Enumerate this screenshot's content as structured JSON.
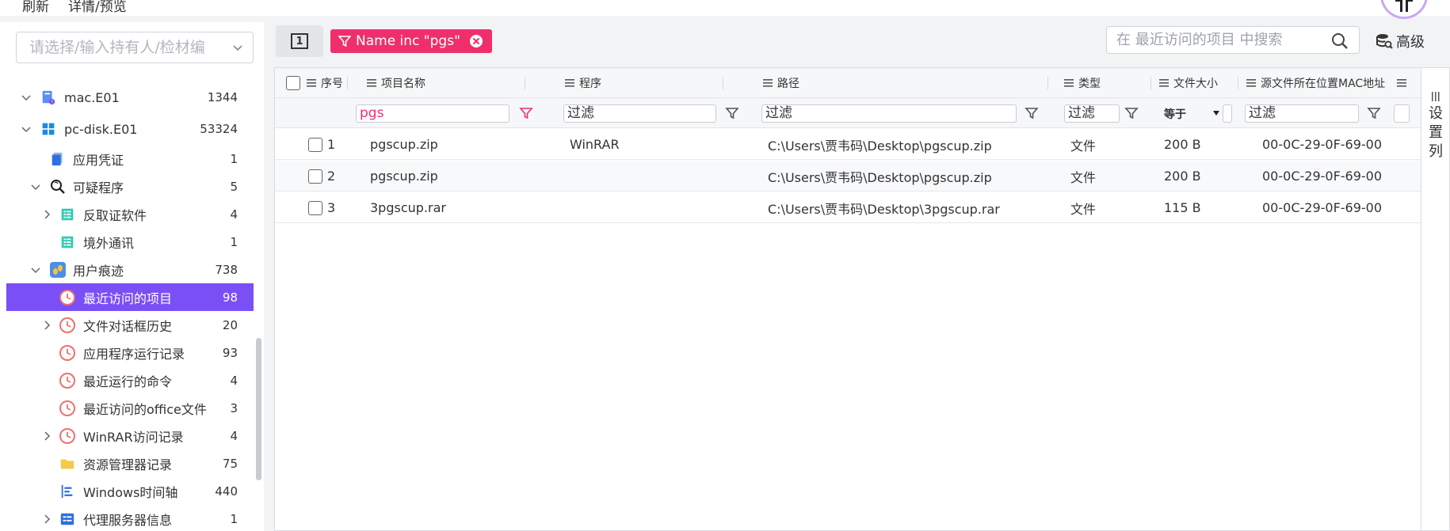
{
  "top_menu": [
    "刷新",
    "详情/预览"
  ],
  "sidebar": {
    "search_placeholder": "请选择/输入持有人/检材编",
    "items": [
      {
        "label": "mac.E01",
        "count": "1344"
      },
      {
        "label": "pc-disk.E01",
        "count": "53324"
      },
      {
        "label": "应用凭证",
        "count": "1"
      },
      {
        "label": "可疑程序",
        "count": "5"
      },
      {
        "label": "反取证软件",
        "count": "4"
      },
      {
        "label": "境外通讯",
        "count": "1"
      },
      {
        "label": "用户痕迹",
        "count": "738"
      },
      {
        "label": "最近访问的项目",
        "count": "98"
      },
      {
        "label": "文件对话框历史",
        "count": "20"
      },
      {
        "label": "应用程序运行记录",
        "count": "93"
      },
      {
        "label": "最近运行的命令",
        "count": "4"
      },
      {
        "label": "最近访问的office文件",
        "count": "3"
      },
      {
        "label": "WinRAR访问记录",
        "count": "4"
      },
      {
        "label": "资源管理器记录",
        "count": "75"
      },
      {
        "label": "Windows时间轴",
        "count": "440"
      },
      {
        "label": "代理服务器信息",
        "count": "1"
      }
    ]
  },
  "toolbar": {
    "view_button": "1",
    "filter_chip": "Name inc \"pgs\"",
    "search_placeholder": "在 最近访问的项目 中搜索",
    "advanced_label": "高级"
  },
  "grid": {
    "columns": [
      "序号",
      "项目名称",
      "程序",
      "路径",
      "类型",
      "文件大小",
      "源文件所在位置MAC地址"
    ],
    "filters": {
      "name_value": "pgs",
      "placeholder": "过滤",
      "size_operator": "等于"
    },
    "rows": [
      {
        "index": "1",
        "name": "pgscup.zip",
        "program": "WinRAR",
        "path": "C:\\Users\\贾韦码\\Desktop\\pgscup.zip",
        "type": "文件",
        "size": "200 B",
        "mac": "00-0C-29-0F-69-00"
      },
      {
        "index": "2",
        "name": "pgscup.zip",
        "program": "",
        "path": "C:\\Users\\贾韦码\\Desktop\\pgscup.zip",
        "type": "文件",
        "size": "200 B",
        "mac": "00-0C-29-0F-69-00"
      },
      {
        "index": "3",
        "name": "3pgscup.rar",
        "program": "",
        "path": "C:\\Users\\贾韦码\\Desktop\\3pgscup.rar",
        "type": "文件",
        "size": "115 B",
        "mac": "00-0C-29-0F-69-00"
      }
    ],
    "side_panel_label": "设置列"
  },
  "colors": {
    "accent": "#7a4ff5",
    "chip": "#ef2f6b"
  }
}
